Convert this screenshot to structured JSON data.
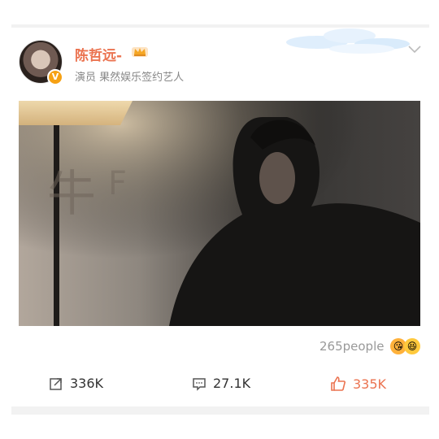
{
  "header": {
    "username": "陈哲远-",
    "subtitle": "演员 果然娱乐签约艺人",
    "verified_glyph": "V",
    "accent": "#eb7350",
    "verified_color": "#f6a114"
  },
  "photo": {
    "description": ""
  },
  "reactions": {
    "count_label": "265people",
    "emojis": [
      "😘",
      "😆"
    ]
  },
  "actions": {
    "share": {
      "icon": "share-icon",
      "count": "336K"
    },
    "comment": {
      "icon": "comment-icon",
      "count": "27.1K"
    },
    "like": {
      "icon": "thumbs-up-icon",
      "count": "335K",
      "color": "#eb7350"
    }
  }
}
